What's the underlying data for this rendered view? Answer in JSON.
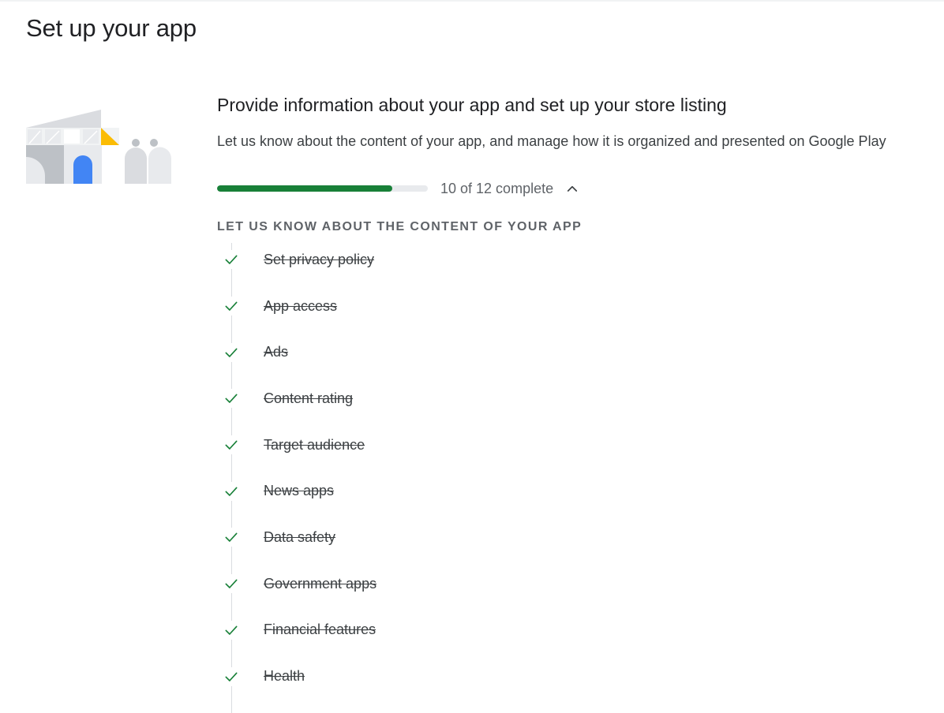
{
  "page": {
    "title": "Set up your app"
  },
  "setup": {
    "title": "Provide information about your app and set up your store listing",
    "description": "Let us know about the content of your app, and manage how it is organized and presented on Google Play",
    "progress": {
      "completed": 10,
      "total": 12,
      "fraction": 0.8333,
      "label": "10 of 12 complete",
      "toggle_icon": "chevron-up-icon"
    },
    "group_heading": "LET US KNOW ABOUT THE CONTENT OF YOUR APP",
    "tasks": [
      {
        "label": "Set privacy policy",
        "done": true
      },
      {
        "label": "App access",
        "done": true
      },
      {
        "label": "Ads",
        "done": true
      },
      {
        "label": "Content rating",
        "done": true
      },
      {
        "label": "Target audience",
        "done": true
      },
      {
        "label": "News apps",
        "done": true
      },
      {
        "label": "Data safety",
        "done": true
      },
      {
        "label": "Government apps",
        "done": true
      },
      {
        "label": "Financial features",
        "done": true
      },
      {
        "label": "Health",
        "done": true
      }
    ]
  },
  "colors": {
    "progress_fill": "#188038",
    "progress_track": "#e8eaed",
    "check": "#188038",
    "illustration_blue": "#4285f4",
    "illustration_yellow": "#fbbc04"
  }
}
